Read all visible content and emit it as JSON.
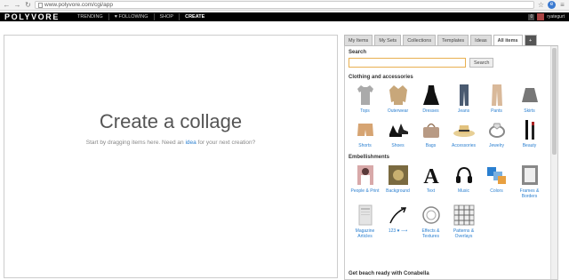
{
  "browser": {
    "url": "www.polyvore.com/cgi/app"
  },
  "header": {
    "logo": "POLYVORE",
    "nav": [
      {
        "label": "TRENDING"
      },
      {
        "label": "♥ FOLLOWING"
      },
      {
        "label": "SHOP"
      },
      {
        "label": "CREATE"
      }
    ],
    "count": "0",
    "username": "ryategurt"
  },
  "canvas": {
    "title": "Create a collage",
    "subtitle_before": "Start by dragging items here. Need an ",
    "subtitle_link": "idea",
    "subtitle_after": " for your next creation?"
  },
  "panel": {
    "tabs": [
      {
        "label": "My Items"
      },
      {
        "label": "My Sets"
      },
      {
        "label": "Collections"
      },
      {
        "label": "Templates"
      },
      {
        "label": "Ideas"
      },
      {
        "label": "All items"
      },
      {
        "label": "+"
      }
    ],
    "search_title": "Search",
    "search_button": "Search",
    "search_value": "",
    "clothing_title": "Clothing and accessories",
    "clothing": [
      {
        "label": "Tops"
      },
      {
        "label": "Outerwear"
      },
      {
        "label": "Dresses"
      },
      {
        "label": "Jeans"
      },
      {
        "label": "Pants"
      },
      {
        "label": "Skirts"
      },
      {
        "label": "Shorts"
      },
      {
        "label": "Shoes"
      },
      {
        "label": "Bags"
      },
      {
        "label": "Accessories"
      },
      {
        "label": "Jewelry"
      },
      {
        "label": "Beauty"
      }
    ],
    "embellishments_title": "Embellishments",
    "embellishments": [
      {
        "label": "People & Print"
      },
      {
        "label": "Background"
      },
      {
        "label": "Text"
      },
      {
        "label": "Music"
      },
      {
        "label": "Colors"
      },
      {
        "label": "Frames & Borders"
      },
      {
        "label": "Magazine Articles"
      },
      {
        "label": "123 ♥ ⟶"
      },
      {
        "label": "Effects & Textures"
      },
      {
        "label": "Patterns & Overlays"
      }
    ],
    "promo": "Get beach ready with Conabella"
  }
}
